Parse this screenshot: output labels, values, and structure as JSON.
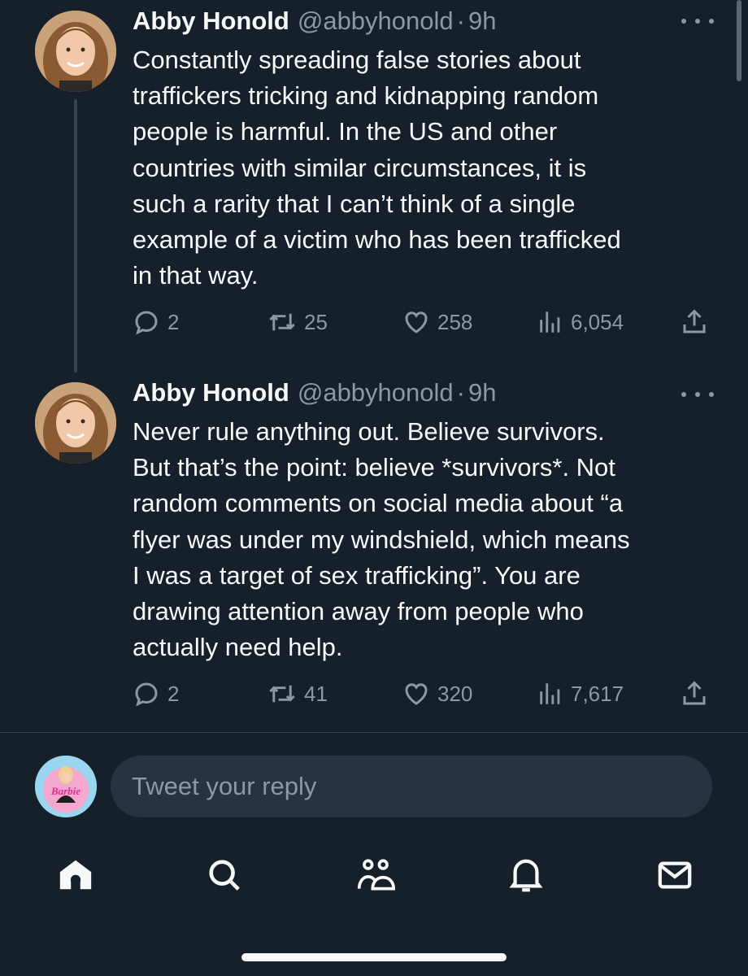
{
  "colors": {
    "background": "#15202b",
    "text_primary": "#f7f9f9",
    "text_secondary": "#8b98a5",
    "divider": "#38444d",
    "reply_box": "#273340"
  },
  "tweets": [
    {
      "author": "Abby Honold",
      "handle": "@abbyhonold",
      "separator": "·",
      "time": "9h",
      "text": "Constantly spreading false stories about\ntraffickers tricking and kidnapping random\npeople is harmful. In the US and other\ncountries with similar circumstances, it is\nsuch a rarity that I can’t think of a single\nexample of a victim who has been trafficked\nin that way.",
      "replies": "2",
      "retweets": "25",
      "likes": "258",
      "views": "6,054"
    },
    {
      "author": "Abby Honold",
      "handle": "@abbyhonold",
      "separator": "·",
      "time": "9h",
      "text": "Never rule anything out. Believe survivors.\nBut that’s the point: believe *survivors*. Not\nrandom comments on social media about “a\nflyer was under my windshield, which means\nI was a target of sex trafficking”. You are\ndrawing attention away from people who\nactually need help.",
      "replies": "2",
      "retweets": "41",
      "likes": "320",
      "views": "7,617"
    }
  ],
  "reply": {
    "placeholder": "Tweet your reply",
    "avatar_text": "Barbie"
  },
  "bottom_nav": [
    "home-icon",
    "search-icon",
    "communities-icon",
    "notifications-icon",
    "messages-icon"
  ]
}
